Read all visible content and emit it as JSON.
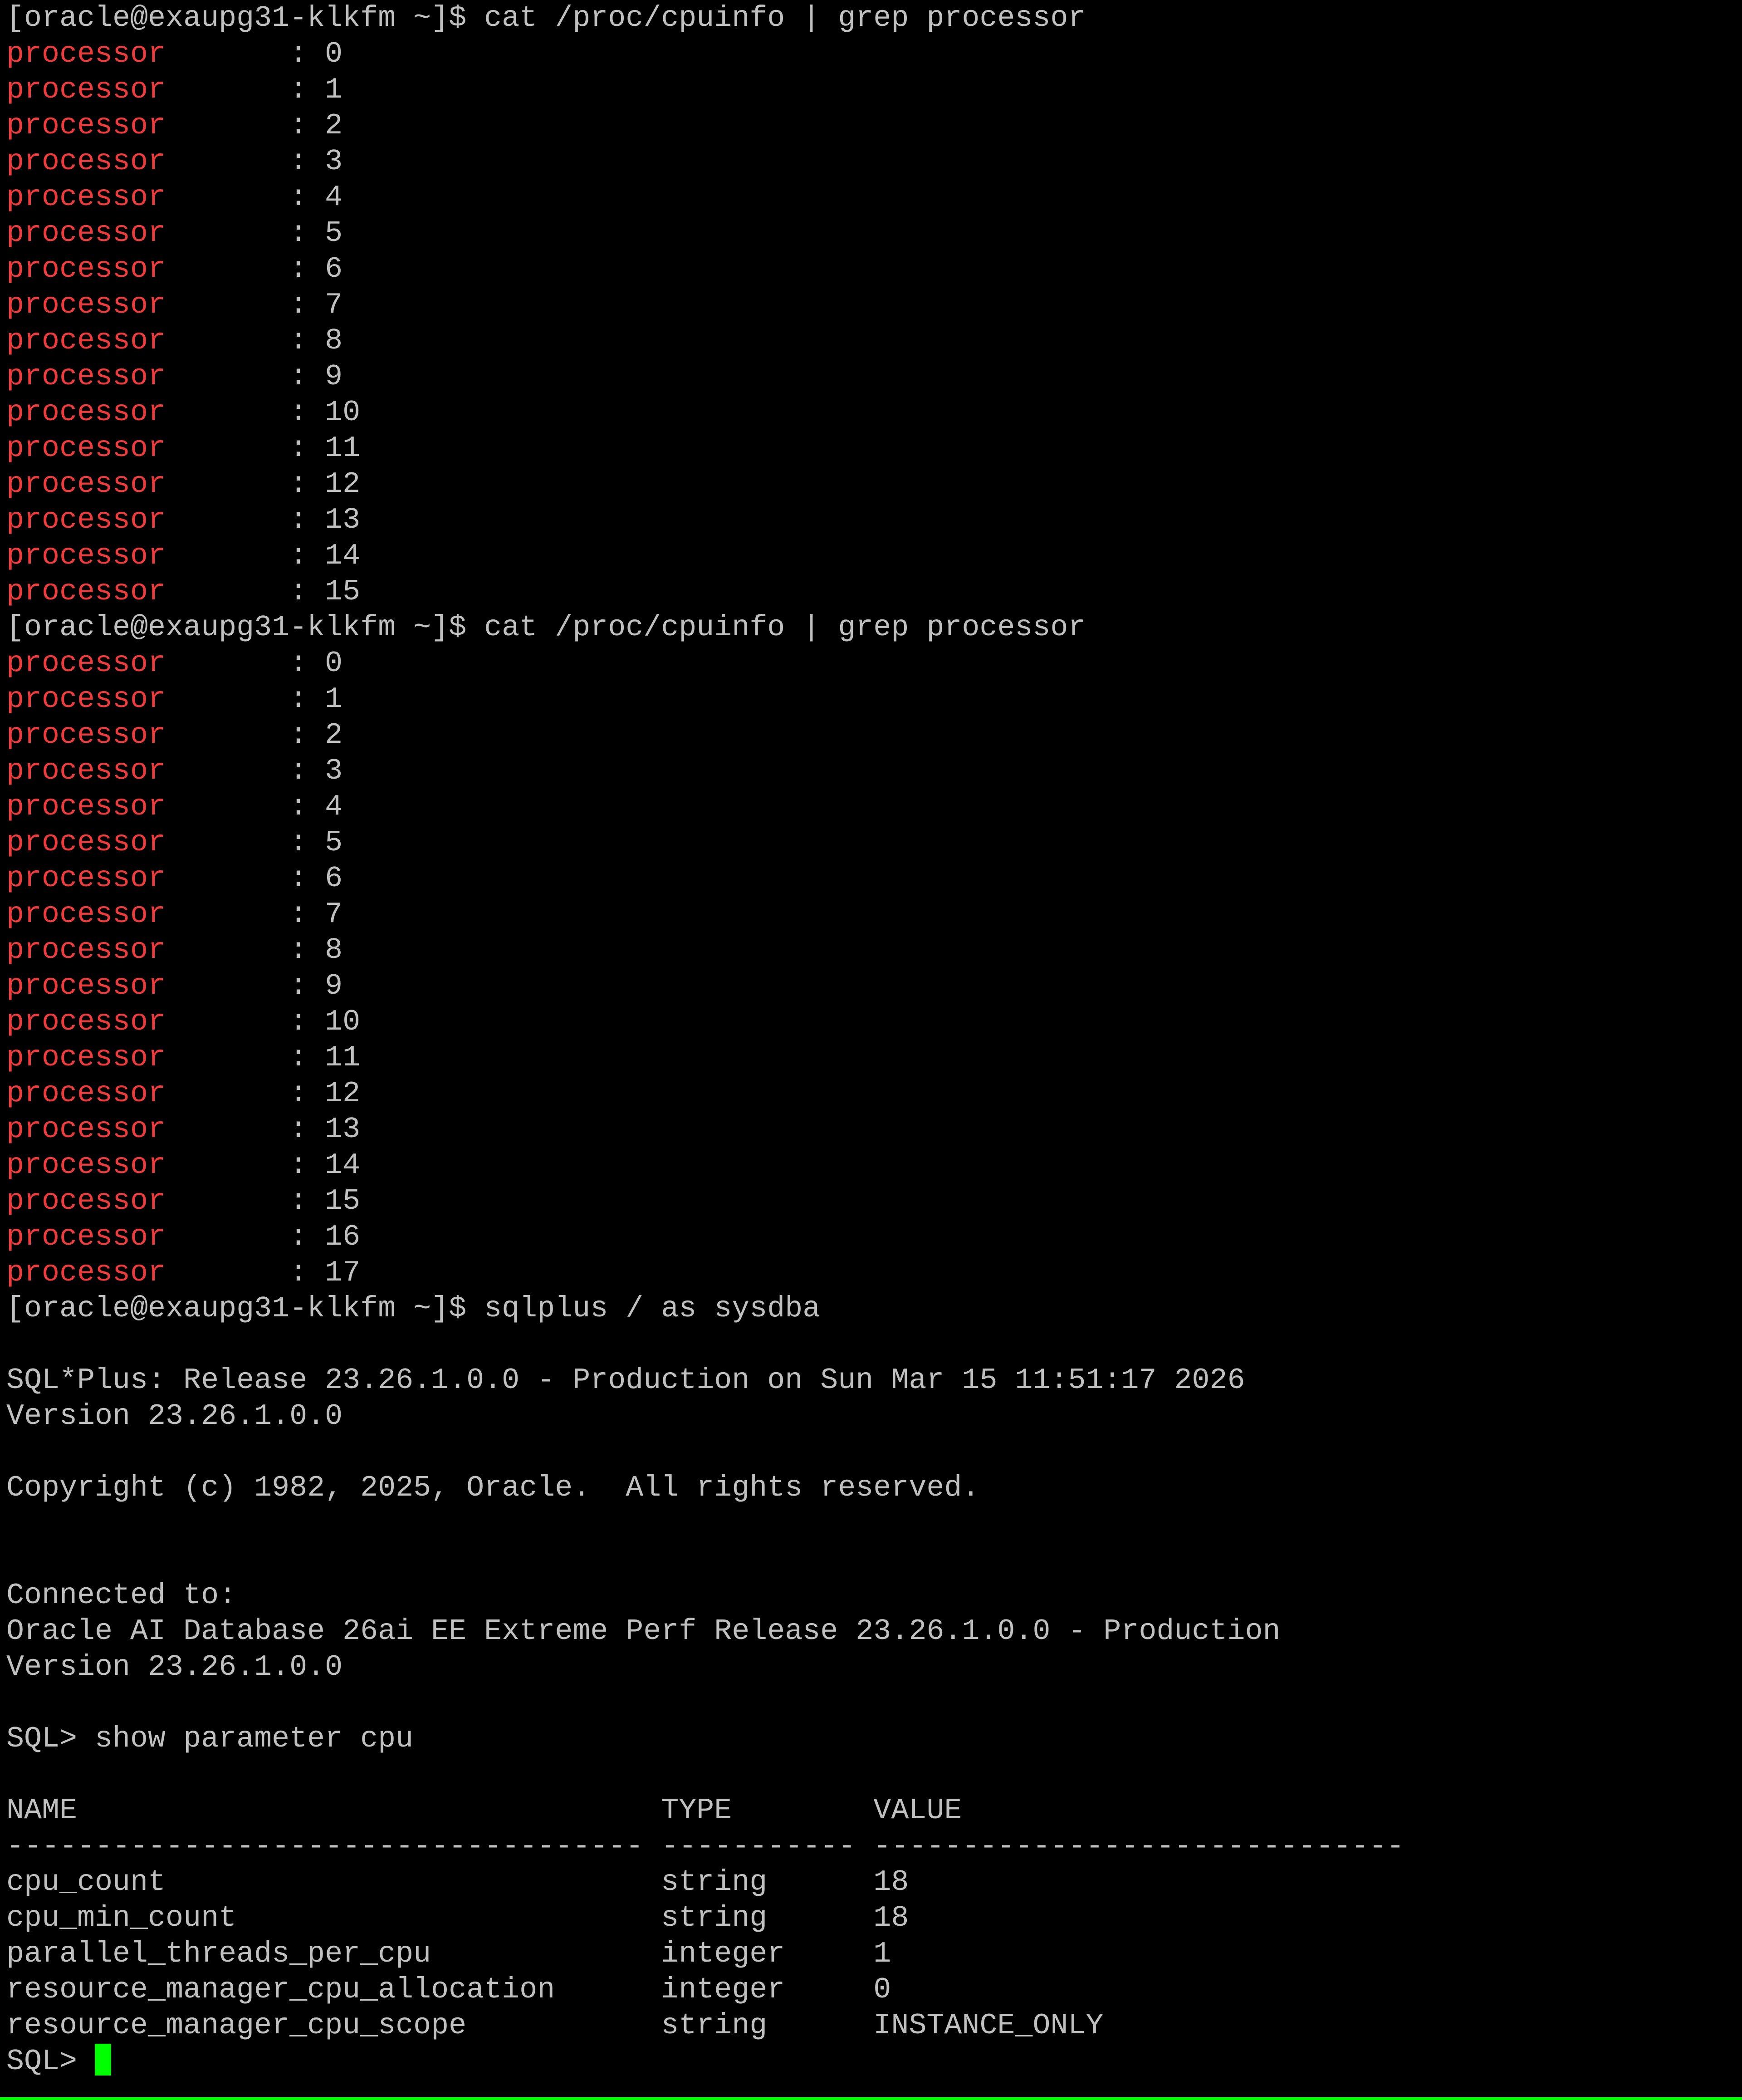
{
  "terminal": {
    "colors": {
      "background": "#000000",
      "text": "#c0c0c0",
      "match_highlight": "#ee3c3c",
      "cursor": "#00ff00"
    },
    "lines": [
      {
        "t": "match",
        "key": "processor",
        "rest": "\t: 15"
      },
      {
        "t": "text",
        "text": "[oracle@exaupg31-klkfm ~]$ cat /proc/cpuinfo | grep processor"
      },
      {
        "t": "match",
        "key": "processor",
        "rest": "\t: 0"
      },
      {
        "t": "match",
        "key": "processor",
        "rest": "\t: 1"
      },
      {
        "t": "match",
        "key": "processor",
        "rest": "\t: 2"
      },
      {
        "t": "match",
        "key": "processor",
        "rest": "\t: 3"
      },
      {
        "t": "match",
        "key": "processor",
        "rest": "\t: 4"
      },
      {
        "t": "match",
        "key": "processor",
        "rest": "\t: 5"
      },
      {
        "t": "match",
        "key": "processor",
        "rest": "\t: 6"
      },
      {
        "t": "match",
        "key": "processor",
        "rest": "\t: 7"
      },
      {
        "t": "match",
        "key": "processor",
        "rest": "\t: 8"
      },
      {
        "t": "match",
        "key": "processor",
        "rest": "\t: 9"
      },
      {
        "t": "match",
        "key": "processor",
        "rest": "\t: 10"
      },
      {
        "t": "match",
        "key": "processor",
        "rest": "\t: 11"
      },
      {
        "t": "match",
        "key": "processor",
        "rest": "\t: 12"
      },
      {
        "t": "match",
        "key": "processor",
        "rest": "\t: 13"
      },
      {
        "t": "match",
        "key": "processor",
        "rest": "\t: 14"
      },
      {
        "t": "match",
        "key": "processor",
        "rest": "\t: 15"
      },
      {
        "t": "text",
        "text": "[oracle@exaupg31-klkfm ~]$ cat /proc/cpuinfo | grep processor"
      },
      {
        "t": "match",
        "key": "processor",
        "rest": "\t: 0"
      },
      {
        "t": "match",
        "key": "processor",
        "rest": "\t: 1"
      },
      {
        "t": "match",
        "key": "processor",
        "rest": "\t: 2"
      },
      {
        "t": "match",
        "key": "processor",
        "rest": "\t: 3"
      },
      {
        "t": "match",
        "key": "processor",
        "rest": "\t: 4"
      },
      {
        "t": "match",
        "key": "processor",
        "rest": "\t: 5"
      },
      {
        "t": "match",
        "key": "processor",
        "rest": "\t: 6"
      },
      {
        "t": "match",
        "key": "processor",
        "rest": "\t: 7"
      },
      {
        "t": "match",
        "key": "processor",
        "rest": "\t: 8"
      },
      {
        "t": "match",
        "key": "processor",
        "rest": "\t: 9"
      },
      {
        "t": "match",
        "key": "processor",
        "rest": "\t: 10"
      },
      {
        "t": "match",
        "key": "processor",
        "rest": "\t: 11"
      },
      {
        "t": "match",
        "key": "processor",
        "rest": "\t: 12"
      },
      {
        "t": "match",
        "key": "processor",
        "rest": "\t: 13"
      },
      {
        "t": "match",
        "key": "processor",
        "rest": "\t: 14"
      },
      {
        "t": "match",
        "key": "processor",
        "rest": "\t: 15"
      },
      {
        "t": "match",
        "key": "processor",
        "rest": "\t: 16"
      },
      {
        "t": "match",
        "key": "processor",
        "rest": "\t: 17"
      },
      {
        "t": "text",
        "text": "[oracle@exaupg31-klkfm ~]$ sqlplus / as sysdba"
      },
      {
        "t": "text",
        "text": ""
      },
      {
        "t": "text",
        "text": "SQL*Plus: Release 23.26.1.0.0 - Production on Sun Mar 15 11:51:17 2026"
      },
      {
        "t": "text",
        "text": "Version 23.26.1.0.0"
      },
      {
        "t": "text",
        "text": ""
      },
      {
        "t": "text",
        "text": "Copyright (c) 1982, 2025, Oracle.  All rights reserved."
      },
      {
        "t": "text",
        "text": ""
      },
      {
        "t": "text",
        "text": ""
      },
      {
        "t": "text",
        "text": "Connected to:"
      },
      {
        "t": "text",
        "text": "Oracle AI Database 26ai EE Extreme Perf Release 23.26.1.0.0 - Production"
      },
      {
        "t": "text",
        "text": "Version 23.26.1.0.0"
      },
      {
        "t": "text",
        "text": ""
      },
      {
        "t": "text",
        "text": "SQL> show parameter cpu"
      },
      {
        "t": "text",
        "text": ""
      },
      {
        "t": "text",
        "text": "NAME                                 TYPE        VALUE"
      },
      {
        "t": "text",
        "text": "------------------------------------ ----------- ------------------------------"
      },
      {
        "t": "text",
        "text": "cpu_count                            string      18"
      },
      {
        "t": "text",
        "text": "cpu_min_count                        string      18"
      },
      {
        "t": "text",
        "text": "parallel_threads_per_cpu             integer     1"
      },
      {
        "t": "text",
        "text": "resource_manager_cpu_allocation      integer     0"
      },
      {
        "t": "text",
        "text": "resource_manager_cpu_scope           string      INSTANCE_ONLY"
      },
      {
        "t": "prompt",
        "text": "SQL>"
      }
    ]
  }
}
